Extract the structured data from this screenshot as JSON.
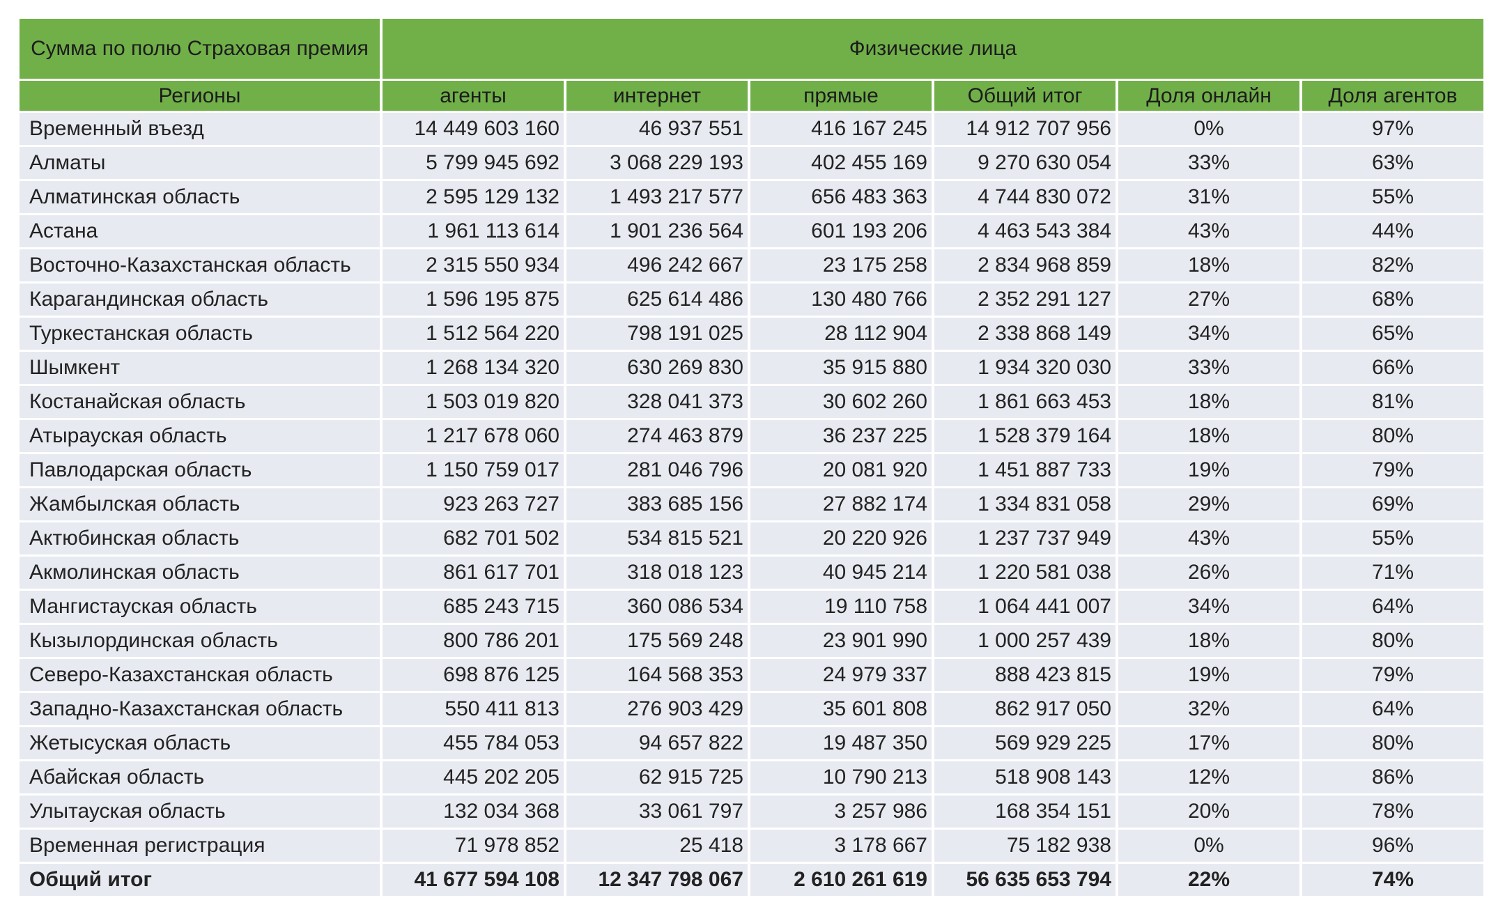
{
  "table": {
    "corner_label": "Сумма по полю Страховая премия",
    "group_label": "Физические лица",
    "columns": [
      "Регионы",
      "агенты",
      "интернет",
      "прямые",
      "Общий итог",
      "Доля онлайн",
      "Доля агентов"
    ],
    "rows": [
      [
        "Временный въезд",
        "14 449 603 160",
        "46 937 551",
        "416 167 245",
        "14 912 707 956",
        "0%",
        "97%"
      ],
      [
        "Алматы",
        "5 799 945 692",
        "3 068 229 193",
        "402 455 169",
        "9 270 630 054",
        "33%",
        "63%"
      ],
      [
        "Алматинская область",
        "2 595 129 132",
        "1 493 217 577",
        "656 483 363",
        "4 744 830 072",
        "31%",
        "55%"
      ],
      [
        "Астана",
        "1 961 113 614",
        "1 901 236 564",
        "601 193 206",
        "4 463 543 384",
        "43%",
        "44%"
      ],
      [
        "Восточно-Казахстанская область",
        "2 315 550 934",
        "496 242 667",
        "23 175 258",
        "2 834 968 859",
        "18%",
        "82%"
      ],
      [
        "Карагандинская область",
        "1 596 195 875",
        "625 614 486",
        "130 480 766",
        "2 352 291 127",
        "27%",
        "68%"
      ],
      [
        "Туркестанская область",
        "1 512 564 220",
        "798 191 025",
        "28 112 904",
        "2 338 868 149",
        "34%",
        "65%"
      ],
      [
        "Шымкент",
        "1 268 134 320",
        "630 269 830",
        "35 915 880",
        "1 934 320 030",
        "33%",
        "66%"
      ],
      [
        "Костанайская область",
        "1 503 019 820",
        "328 041 373",
        "30 602 260",
        "1 861 663 453",
        "18%",
        "81%"
      ],
      [
        "Атырауская область",
        "1 217 678 060",
        "274 463 879",
        "36 237 225",
        "1 528 379 164",
        "18%",
        "80%"
      ],
      [
        "Павлодарская область",
        "1 150 759 017",
        "281 046 796",
        "20 081 920",
        "1 451 887 733",
        "19%",
        "79%"
      ],
      [
        "Жамбылская область",
        "923 263 727",
        "383 685 156",
        "27 882 174",
        "1 334 831 058",
        "29%",
        "69%"
      ],
      [
        "Актюбинская область",
        "682 701 502",
        "534 815 521",
        "20 220 926",
        "1 237 737 949",
        "43%",
        "55%"
      ],
      [
        "Акмолинская область",
        "861 617 701",
        "318 018 123",
        "40 945 214",
        "1 220 581 038",
        "26%",
        "71%"
      ],
      [
        "Мангистауская область",
        "685 243 715",
        "360 086 534",
        "19 110 758",
        "1 064 441 007",
        "34%",
        "64%"
      ],
      [
        "Кызылординская область",
        "800 786 201",
        "175 569 248",
        "23 901 990",
        "1 000 257 439",
        "18%",
        "80%"
      ],
      [
        "Северо-Казахстанская область",
        "698 876 125",
        "164 568 353",
        "24 979 337",
        "888 423 815",
        "19%",
        "79%"
      ],
      [
        "Западно-Казахстанская область",
        "550 411 813",
        "276 903 429",
        "35 601 808",
        "862 917 050",
        "32%",
        "64%"
      ],
      [
        "Жетысуская область",
        "455 784 053",
        "94 657 822",
        "19 487 350",
        "569 929 225",
        "17%",
        "80%"
      ],
      [
        "Абайская область",
        "445 202 205",
        "62 915 725",
        "10 790 213",
        "518 908 143",
        "12%",
        "86%"
      ],
      [
        "Улытауская область",
        "132 034 368",
        "33 061 797",
        "3 257 986",
        "168 354 151",
        "20%",
        "78%"
      ],
      [
        "Временная регистрация",
        "71 978 852",
        "25 418",
        "3 178 667",
        "75 182 938",
        "0%",
        "96%"
      ]
    ],
    "total": [
      "Общий итог",
      "41 677 594 108",
      "12 347 798 067",
      "2 610 261 619",
      "56 635 653 794",
      "22%",
      "74%"
    ]
  },
  "colors": {
    "header_green": "#71b049",
    "row_background": "#e8eaf1",
    "text": "#222222"
  }
}
